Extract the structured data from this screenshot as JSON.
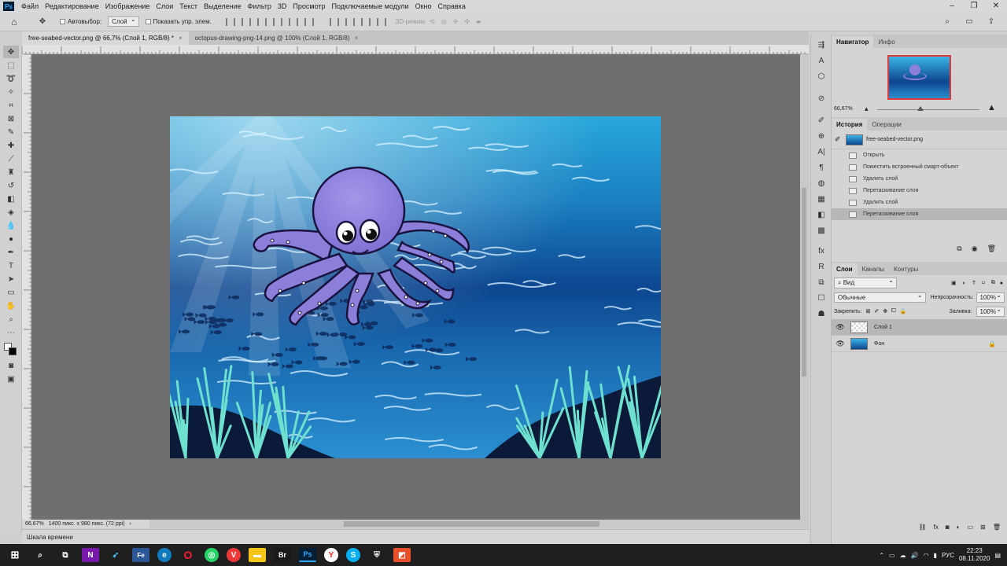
{
  "menu": {
    "app_icon": "Ps",
    "items": [
      "Файл",
      "Редактирование",
      "Изображение",
      "Слои",
      "Текст",
      "Выделение",
      "Фильтр",
      "3D",
      "Просмотр",
      "Подключаемые модули",
      "Окно",
      "Справка"
    ]
  },
  "options_bar": {
    "autoselect_label": "Автовыбор:",
    "autoselect_value": "Слой",
    "show_controls_label": "Показать упр. элем.",
    "mode_3d_label": "3D-режим:"
  },
  "tabs": [
    {
      "label": "free-seabed-vector.png @ 66,7% (Слой 1, RGB/8) *",
      "close": "×"
    },
    {
      "label": "octopus-drawing-png-14.png @ 100% (Слой 1, RGB/8)",
      "close": "×"
    }
  ],
  "status": {
    "zoom": "66,67%",
    "doc_info": "1400 пикс. x 980 пикс. (72 ppi)",
    "arrow": "›"
  },
  "timeline": {
    "label": "Шкала времени"
  },
  "navigator": {
    "tabs": [
      "Навигатор",
      "Инфо"
    ],
    "zoom": "66,67%",
    "zoom_level": 0.42
  },
  "history": {
    "tabs": [
      "История",
      "Операции"
    ],
    "snapshot": "free-seabed-vector.png",
    "items": [
      "Открыть",
      "Поместить встроенный смарт-объект",
      "Удалить слой",
      "Перетаскивание слоя",
      "Удалить слой",
      "Перетаскивание слоя"
    ],
    "selected_index": 5
  },
  "layers": {
    "tabs": [
      "Слои",
      "Каналы",
      "Контуры"
    ],
    "filter_label": "Вид",
    "blend_mode": "Обычные",
    "opacity_label": "Непрозрачность:",
    "opacity_value": "100%",
    "lock_label": "Закрепить:",
    "fill_label": "Заливка:",
    "fill_value": "100%",
    "items": [
      {
        "name": "Слой 1",
        "selected": true
      },
      {
        "name": "Фон",
        "selected": false
      }
    ]
  },
  "taskbar": {
    "language": "РУС",
    "time": "22:23",
    "date": "08.11.2020"
  },
  "colors": {
    "ps_blue": "#31a8ff",
    "octopus": "#8c7fd9",
    "water_dark": "#0b2f6b",
    "water_light": "#2a9fd6"
  }
}
